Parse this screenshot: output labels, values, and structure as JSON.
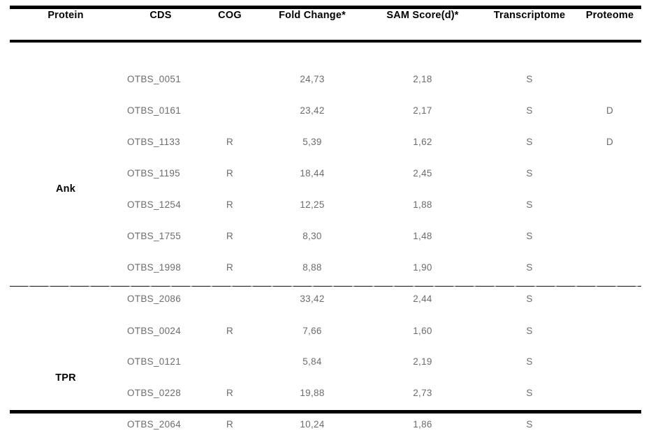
{
  "table": {
    "columns": [
      {
        "key": "protein",
        "label": "Protein"
      },
      {
        "key": "cds",
        "label": "CDS"
      },
      {
        "key": "cog",
        "label": "COG"
      },
      {
        "key": "fold_change",
        "label": "Fold Change*"
      },
      {
        "key": "sam_score",
        "label": "SAM Score(d)*"
      },
      {
        "key": "transcriptome",
        "label": "Transcriptome"
      },
      {
        "key": "proteome",
        "label": "Proteome"
      }
    ],
    "groups": [
      {
        "protein": "Ank",
        "rows": [
          {
            "cds": "OTBS_0051",
            "cog": "",
            "fold_change": "24,73",
            "sam_score": "2,18",
            "transcriptome": "S",
            "proteome": ""
          },
          {
            "cds": "OTBS_0161",
            "cog": "",
            "fold_change": "23,42",
            "sam_score": "2,17",
            "transcriptome": "S",
            "proteome": "D"
          },
          {
            "cds": "OTBS_1133",
            "cog": "R",
            "fold_change": "5,39",
            "sam_score": "1,62",
            "transcriptome": "S",
            "proteome": "D"
          },
          {
            "cds": "OTBS_1195",
            "cog": "R",
            "fold_change": "18,44",
            "sam_score": "2,45",
            "transcriptome": "S",
            "proteome": ""
          },
          {
            "cds": "OTBS_1254",
            "cog": "R",
            "fold_change": "12,25",
            "sam_score": "1,88",
            "transcriptome": "S",
            "proteome": ""
          },
          {
            "cds": "OTBS_1755",
            "cog": "R",
            "fold_change": "8,30",
            "sam_score": "1,48",
            "transcriptome": "S",
            "proteome": ""
          },
          {
            "cds": "OTBS_1998",
            "cog": "R",
            "fold_change": "8,88",
            "sam_score": "1,90",
            "transcriptome": "S",
            "proteome": ""
          },
          {
            "cds": "OTBS_2086",
            "cog": "",
            "fold_change": "33,42",
            "sam_score": "2,44",
            "transcriptome": "S",
            "proteome": ""
          }
        ]
      },
      {
        "protein": "TPR",
        "rows": [
          {
            "cds": "OTBS_0024",
            "cog": "R",
            "fold_change": "7,66",
            "sam_score": "1,60",
            "transcriptome": "S",
            "proteome": ""
          },
          {
            "cds": "OTBS_0121",
            "cog": "",
            "fold_change": "5,84",
            "sam_score": "2,19",
            "transcriptome": "S",
            "proteome": ""
          },
          {
            "cds": "OTBS_0228",
            "cog": "R",
            "fold_change": "19,88",
            "sam_score": "2,73",
            "transcriptome": "S",
            "proteome": ""
          },
          {
            "cds": "OTBS_2064",
            "cog": "R",
            "fold_change": "10,24",
            "sam_score": "1,86",
            "transcriptome": "S",
            "proteome": ""
          }
        ]
      }
    ]
  },
  "colors": {
    "rule": "#000000",
    "header_text": "#000000",
    "body_text": "#6c6c6c",
    "background": "#ffffff"
  }
}
